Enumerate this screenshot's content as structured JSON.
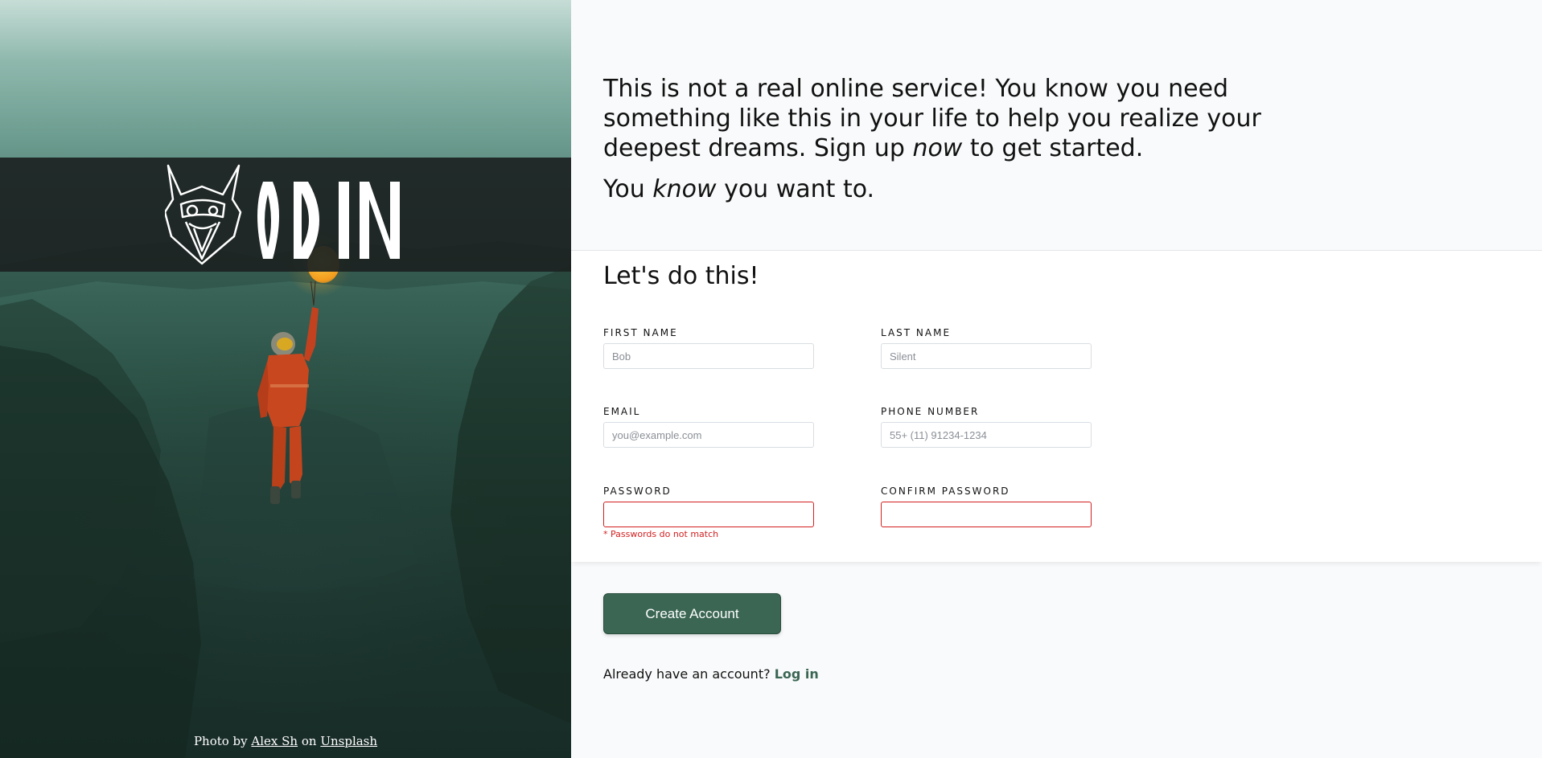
{
  "hero": {
    "logo_text": "ODIN",
    "credit_prefix": "Photo by",
    "credit_author": "Alex Sh",
    "credit_mid": "on",
    "credit_site": "Unsplash"
  },
  "intro": {
    "line1_a": "This is not a real online service! You know you need something like this in your life to help you realize your deepest dreams. Sign up ",
    "line1_em": "now",
    "line1_b": " to get started.",
    "line2_a": "You ",
    "line2_em": "know",
    "line2_b": " you want to."
  },
  "form": {
    "title": "Let's do this!",
    "first_name": {
      "label": "FIRST NAME",
      "placeholder": "Bob",
      "value": ""
    },
    "last_name": {
      "label": "LAST NAME",
      "placeholder": "Silent",
      "value": ""
    },
    "email": {
      "label": "EMAIL",
      "placeholder": "you@example.com",
      "value": ""
    },
    "phone": {
      "label": "PHONE NUMBER",
      "placeholder": "55+ (11) 91234-1234",
      "value": ""
    },
    "password": {
      "label": "PASSWORD",
      "placeholder": "",
      "value": ""
    },
    "confirm_password": {
      "label": "CONFIRM PASSWORD",
      "placeholder": "",
      "value": ""
    },
    "password_error": "* Passwords do not match"
  },
  "actions": {
    "create_label": "Create Account",
    "login_prompt": "Already have an account?",
    "login_link": "Log in"
  },
  "colors": {
    "accent": "#3a6653",
    "error": "#d21f1f"
  }
}
